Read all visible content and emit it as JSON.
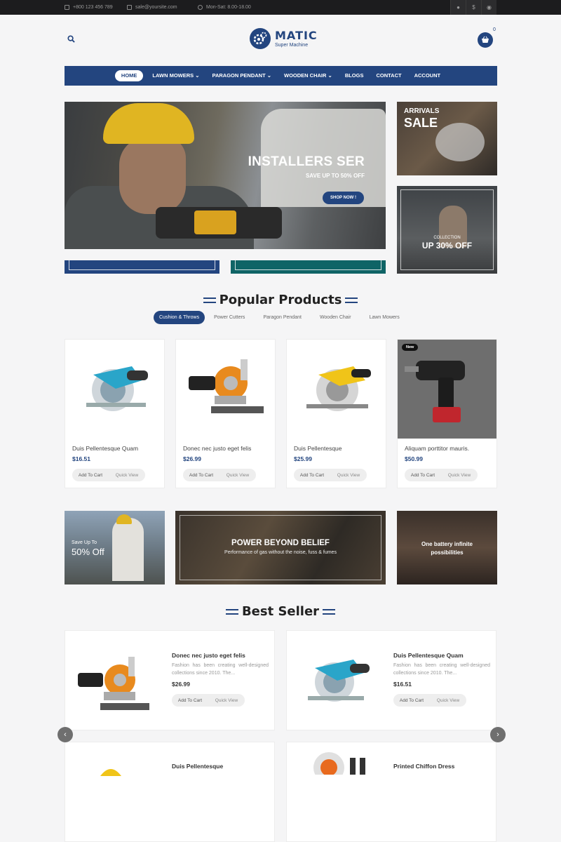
{
  "topbar": {
    "phone": "+800 123 456 789",
    "email": "sale@yoursite.com",
    "hours": "Mon-Sat: 8.00-18.00",
    "account_icon": "user-icon",
    "currency_icon": "$",
    "language_icon": "globe-icon"
  },
  "logo": {
    "name": "MATIC",
    "tagline": "Super Machine"
  },
  "cart": {
    "count": "0"
  },
  "nav": {
    "items": [
      {
        "label": "HOME"
      },
      {
        "label": "LAWN MOWERS ⌄"
      },
      {
        "label": "PARAGON PENDANT ⌄"
      },
      {
        "label": "WOODEN CHAIR ⌄"
      },
      {
        "label": "BLOGS"
      },
      {
        "label": "CONTACT"
      },
      {
        "label": "ACCOUNT"
      }
    ]
  },
  "hero": {
    "title": "INSTALLERS SER",
    "subtitle": "SAVE UP TO 50% OFF",
    "button": "SHOP NOW !"
  },
  "side_banners": [
    {
      "line1": "ARRIVALS",
      "line2": "SALE"
    },
    {
      "line1": "COLLECTION",
      "line2": "UP 30% OFF"
    }
  ],
  "popular": {
    "title": "Popular Products",
    "tabs": [
      "Cushion & Throws",
      "Power Cutters",
      "Paragon Pendant",
      "Wooden Chair",
      "Lawn Mowers"
    ],
    "products": [
      {
        "name": "Duis Pellentesque Quam",
        "price": "$16.51",
        "add": "Add To Cart",
        "quick": "Quick View"
      },
      {
        "name": "Donec nec justo eget felis",
        "price": "$26.99",
        "add": "Add To Cart",
        "quick": "Quick View"
      },
      {
        "name": "Duis Pellentesque",
        "price": "$25.99",
        "add": "Add To Cart",
        "quick": "Quick View"
      },
      {
        "name": "Aliquam porttitor mauris.",
        "price": "$50.99",
        "add": "Add To Cart",
        "quick": "Quick View",
        "badge": "New"
      }
    ]
  },
  "promo": {
    "left": {
      "line1": "Save Up To",
      "line2": "50% Off"
    },
    "center": {
      "title": "POWER BEYOND BELIEF",
      "subtitle": "Performance of gas without the noise, fuss & fumes"
    },
    "right": {
      "line1": "One battery infinite",
      "line2": "possibilities"
    }
  },
  "best_seller": {
    "title": "Best Seller",
    "items": [
      {
        "name": "Donec nec justo eget felis",
        "desc": "Fashion has been creating well-designed collections since 2010. The...",
        "price": "$26.99",
        "add": "Add To Cart",
        "quick": "Quick View"
      },
      {
        "name": "Duis Pellentesque Quam",
        "desc": "Fashion has been creating well-designed collections since 2010. The...",
        "price": "$16.51",
        "add": "Add To Cart",
        "quick": "Quick View"
      },
      {
        "name": "Duis Pellentesque"
      },
      {
        "name": "Printed Chiffon Dress"
      }
    ],
    "prev": "‹",
    "next": "›"
  }
}
